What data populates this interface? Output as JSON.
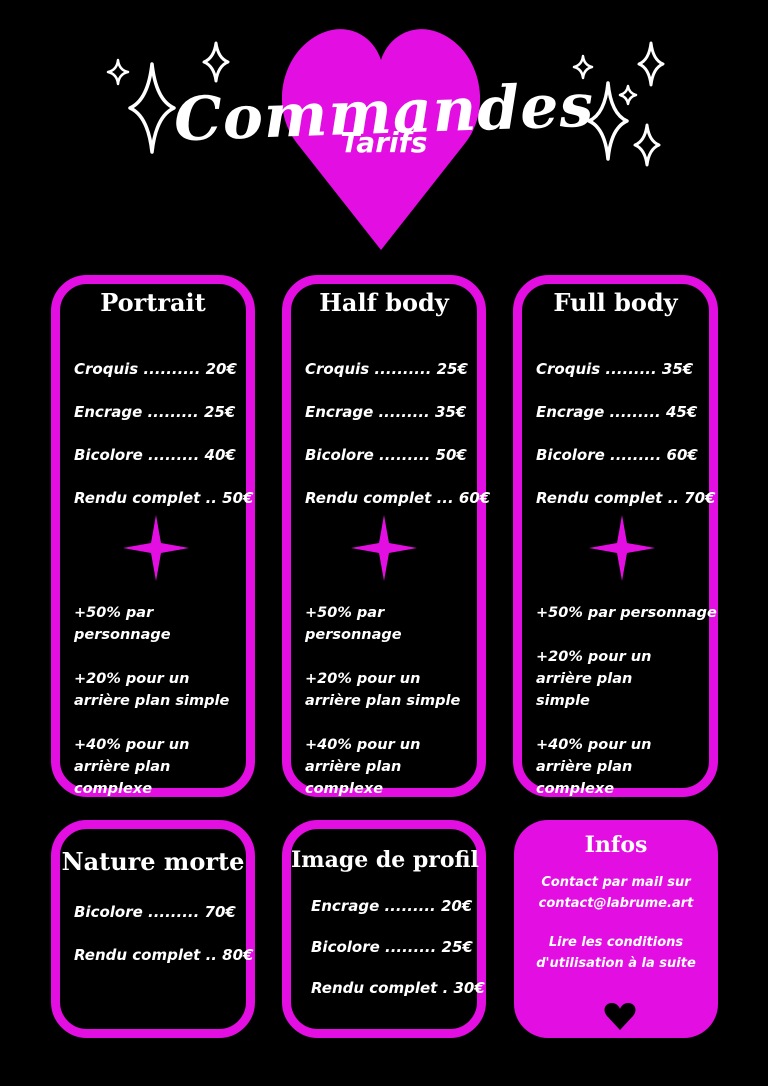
{
  "header": {
    "title": "Commandes",
    "subtitle": "Tarifs"
  },
  "colors": {
    "accent": "#e20ee2",
    "background": "#000000",
    "text": "#ffffff"
  },
  "cards": [
    {
      "title": "Portrait",
      "prices": [
        "Croquis .......... 20€",
        "Encrage ......... 25€",
        "Bicolore ......... 40€",
        "Rendu complet .. 50€"
      ],
      "extras": [
        "+50% par personnage",
        "+20% pour un arrière plan simple",
        "+40% pour un arrière plan complexe"
      ]
    },
    {
      "title": "Half body",
      "prices": [
        "Croquis .......... 25€",
        "Encrage ......... 35€",
        "Bicolore ......... 50€",
        "Rendu complet ... 60€"
      ],
      "extras": [
        "+50% par personnage",
        "+20% pour un arrière plan simple",
        "+40% pour un arrière plan complexe"
      ]
    },
    {
      "title": "Full body",
      "prices": [
        "Croquis ......... 35€",
        "Encrage ......... 45€",
        "Bicolore ......... 60€",
        "Rendu complet .. 70€"
      ],
      "extras": [
        "+50% par personnage",
        "+20% pour un arrière plan simple",
        "+40% pour un arrière plan complexe"
      ]
    }
  ],
  "nature": {
    "title": "Nature morte",
    "prices": [
      "Bicolore ......... 70€",
      "Rendu complet .. 80€"
    ]
  },
  "profil": {
    "title": "Image de profil",
    "prices": [
      "Encrage ......... 20€",
      "Bicolore ......... 25€",
      "Rendu complet . 30€"
    ]
  },
  "infos": {
    "title": "Infos",
    "contact_line1": "Contact par mail sur",
    "contact_line2": "contact@labrume.art",
    "terms_line1": "Lire les conditions",
    "terms_line2": "d'utilisation à la suite",
    "icon": "heart-icon"
  }
}
